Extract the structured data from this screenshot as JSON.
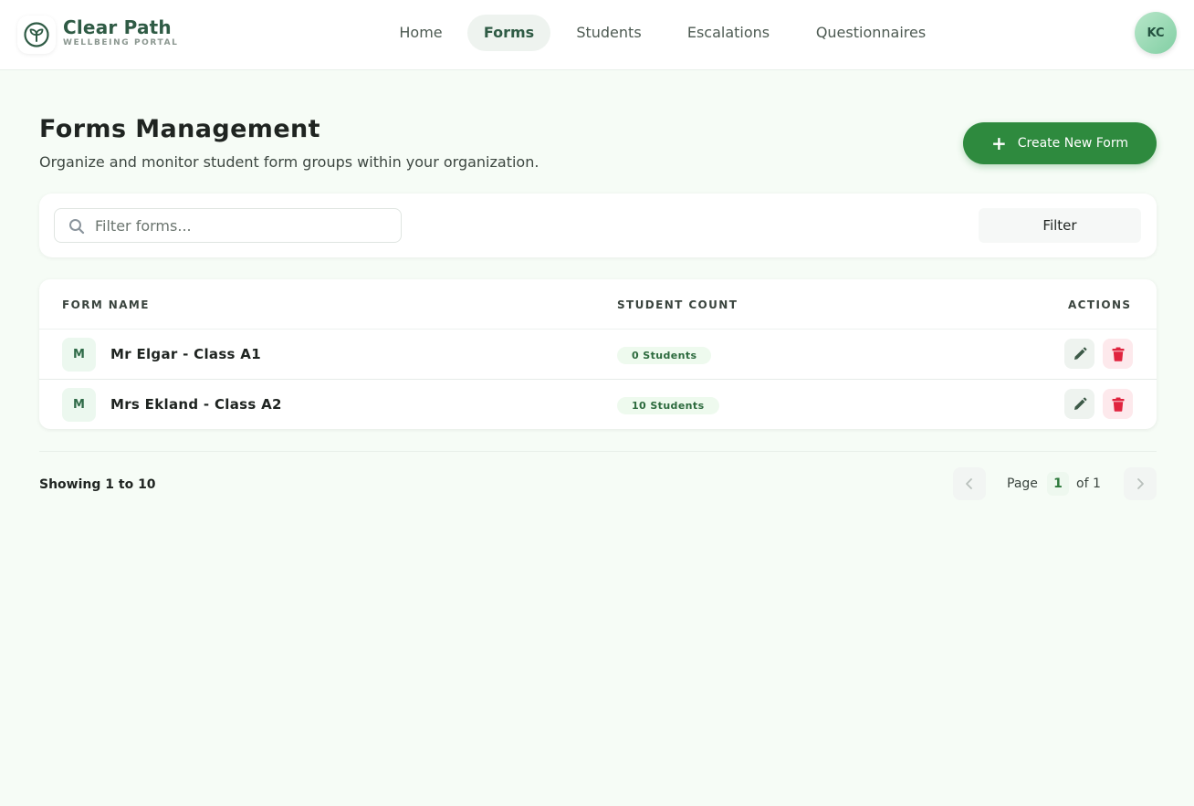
{
  "brand": {
    "name": "Clear Path",
    "subtitle": "WELLBEING PORTAL",
    "logo_icon": "sprout-icon"
  },
  "nav": {
    "items": [
      {
        "label": "Home",
        "active": false
      },
      {
        "label": "Forms",
        "active": true
      },
      {
        "label": "Students",
        "active": false
      },
      {
        "label": "Escalations",
        "active": false
      },
      {
        "label": "Questionnaires",
        "active": false
      }
    ]
  },
  "user": {
    "initials": "KC"
  },
  "page": {
    "title": "Forms Management",
    "subtitle": "Organize and monitor student form groups within your organization."
  },
  "actions": {
    "create_label": "Create New Form",
    "create_icon": "plus-icon"
  },
  "search": {
    "placeholder": "Filter forms...",
    "value": ""
  },
  "filter": {
    "label": "Filter"
  },
  "table": {
    "headers": [
      "FORM NAME",
      "STUDENT COUNT",
      "ACTIONS"
    ],
    "rows": [
      {
        "initial": "M",
        "name": "Mr Elgar - Class A1",
        "count": "0 Students"
      },
      {
        "initial": "M",
        "name": "Mrs Ekland - Class A2",
        "count": "10 Students"
      }
    ]
  },
  "pagination": {
    "showing": "Showing 1 to 10",
    "page_label": "Page",
    "current": "1",
    "of_label": "of 1"
  },
  "colors": {
    "accent": "#2e8a3e",
    "brand_text": "#2f5b45",
    "delete": "#e0243f",
    "edit": "#3d5a48",
    "background": "#f6fcf6"
  }
}
